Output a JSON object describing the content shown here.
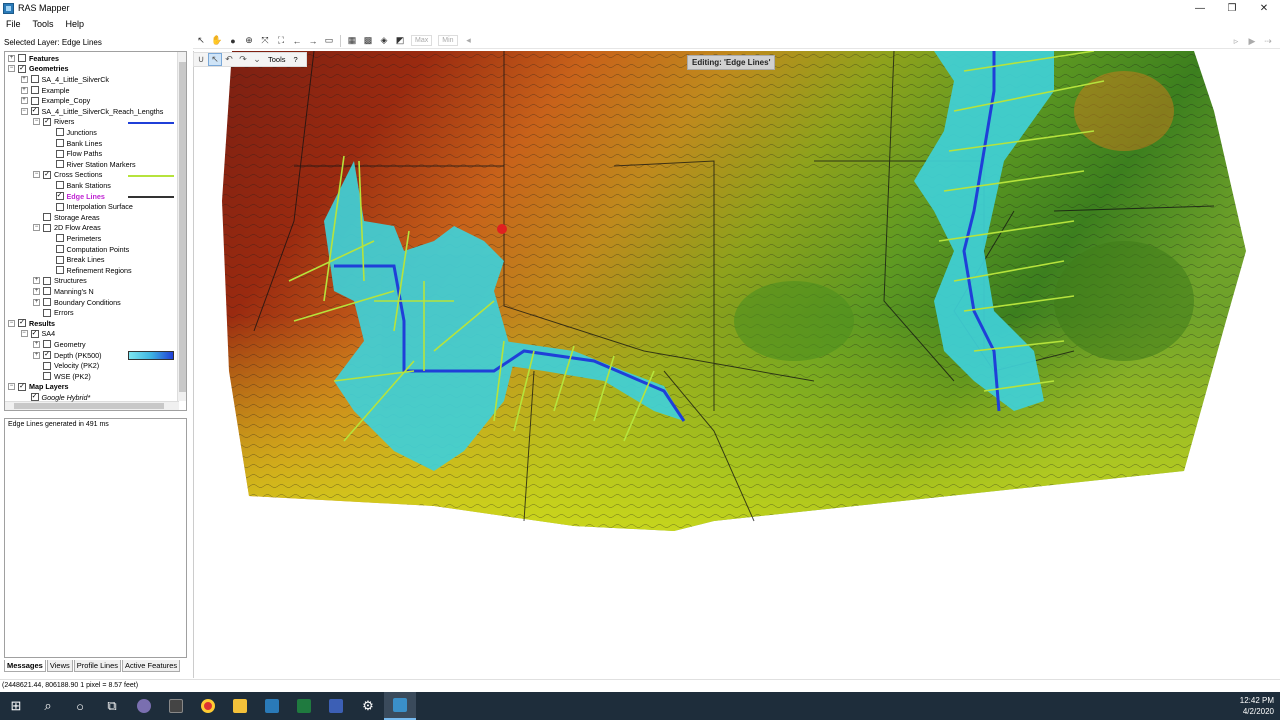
{
  "window": {
    "title": "RAS Mapper",
    "minimize": "—",
    "restore": "❐",
    "close": "✕"
  },
  "menu": [
    "File",
    "Tools",
    "Help"
  ],
  "selected_layer": "Selected Layer: Edge Lines",
  "map_toolbar": {
    "max_label": "Max",
    "min_label": "Min"
  },
  "edit_toolbar": {
    "tools_label": "Tools",
    "help_label": "?"
  },
  "editing_badge": "Editing: 'Edge Lines'",
  "layers": [
    {
      "label": "Features",
      "indent": 0,
      "expander": "+",
      "checked": false,
      "bold": true
    },
    {
      "label": "Geometries",
      "indent": 0,
      "expander": "-",
      "checked": true,
      "bold": true
    },
    {
      "label": "SA_4_Little_SilverCk",
      "indent": 1,
      "expander": "+",
      "checked": false
    },
    {
      "label": "Example",
      "indent": 1,
      "expander": "+",
      "checked": false
    },
    {
      "label": "Example_Copy",
      "indent": 1,
      "expander": "+",
      "checked": false
    },
    {
      "label": "SA_4_Little_SilverCk_Reach_Lengths",
      "indent": 1,
      "expander": "-",
      "checked": true
    },
    {
      "label": "Rivers",
      "indent": 2,
      "expander": "-",
      "checked": true,
      "legend": "#1f3fd8"
    },
    {
      "label": "Junctions",
      "indent": 3,
      "expander": "",
      "checked": false
    },
    {
      "label": "Bank Lines",
      "indent": 3,
      "expander": "",
      "checked": false
    },
    {
      "label": "Flow Paths",
      "indent": 3,
      "expander": "",
      "checked": false
    },
    {
      "label": "River Station Markers",
      "indent": 3,
      "expander": "",
      "checked": false
    },
    {
      "label": "Cross Sections",
      "indent": 2,
      "expander": "-",
      "checked": true,
      "legend": "#b6e33c"
    },
    {
      "label": "Bank Stations",
      "indent": 3,
      "expander": "",
      "checked": false
    },
    {
      "label": "Edge Lines",
      "indent": 3,
      "expander": "",
      "checked": true,
      "highlight": true,
      "legend": "#333333"
    },
    {
      "label": "Interpolation Surface",
      "indent": 3,
      "expander": "",
      "checked": false
    },
    {
      "label": "Storage Areas",
      "indent": 2,
      "expander": "",
      "checked": false
    },
    {
      "label": "2D Flow Areas",
      "indent": 2,
      "expander": "-",
      "checked": false
    },
    {
      "label": "Perimeters",
      "indent": 3,
      "expander": "",
      "checked": false
    },
    {
      "label": "Computation Points",
      "indent": 3,
      "expander": "",
      "checked": false
    },
    {
      "label": "Break Lines",
      "indent": 3,
      "expander": "",
      "checked": false
    },
    {
      "label": "Refinement Regions",
      "indent": 3,
      "expander": "",
      "checked": false
    },
    {
      "label": "Structures",
      "indent": 2,
      "expander": "+",
      "checked": false
    },
    {
      "label": "Manning's N",
      "indent": 2,
      "expander": "+",
      "checked": false
    },
    {
      "label": "Boundary Conditions",
      "indent": 2,
      "expander": "+",
      "checked": false
    },
    {
      "label": "Errors",
      "indent": 2,
      "expander": "",
      "checked": false
    },
    {
      "label": "Results",
      "indent": 0,
      "expander": "-",
      "checked": true,
      "bold": true
    },
    {
      "label": "SA4",
      "indent": 1,
      "expander": "-",
      "checked": true
    },
    {
      "label": "Geometry",
      "indent": 2,
      "expander": "+",
      "checked": false
    },
    {
      "label": "Depth (PK500)",
      "indent": 2,
      "expander": "+",
      "checked": true,
      "gradient": true
    },
    {
      "label": "Velocity (PK2)",
      "indent": 2,
      "expander": "",
      "checked": false
    },
    {
      "label": "WSE (PK2)",
      "indent": 2,
      "expander": "",
      "checked": false
    },
    {
      "label": "Map Layers",
      "indent": 0,
      "expander": "-",
      "checked": true,
      "bold": true
    },
    {
      "label": "Google Hybrid*",
      "indent": 1,
      "expander": "",
      "checked": true,
      "italic": true
    }
  ],
  "messages": "Edge Lines generated in 491 ms",
  "bottom_tabs": [
    "Messages",
    "Views",
    "Profile Lines",
    "Active Features"
  ],
  "status": "(2448621.44, 806188.90  1 pixel = 8.57 feet)",
  "clock": {
    "time": "12:42 PM",
    "date": "4/2/2020"
  },
  "colors": {
    "river": "#1f3fd8",
    "cross_section": "#b6e33c",
    "depth": "#3fd0d8"
  }
}
